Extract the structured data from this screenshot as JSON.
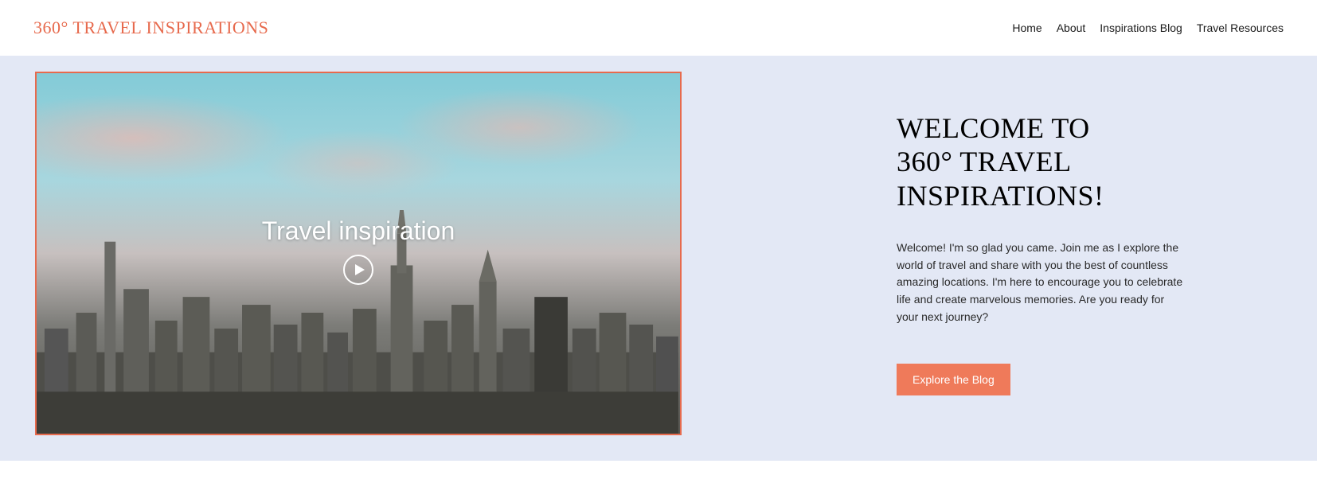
{
  "header": {
    "logo": "360° TRAVEL INSPIRATIONS",
    "nav": {
      "home": "Home",
      "about": "About",
      "blog": "Inspirations Blog",
      "resources": "Travel Resources"
    }
  },
  "hero": {
    "video_title": "Travel inspiration",
    "welcome_heading_line1": "WELCOME TO",
    "welcome_heading_line2": "360° TRAVEL",
    "welcome_heading_line3": "INSPIRATIONS!",
    "welcome_body": "Welcome! I'm so glad you came. Join me as I explore the world of travel and share with you the best of countless amazing locations. I'm here to encourage you to celebrate life and create marvelous memories. Are you ready for your next journey?",
    "cta_label": "Explore the Blog"
  }
}
